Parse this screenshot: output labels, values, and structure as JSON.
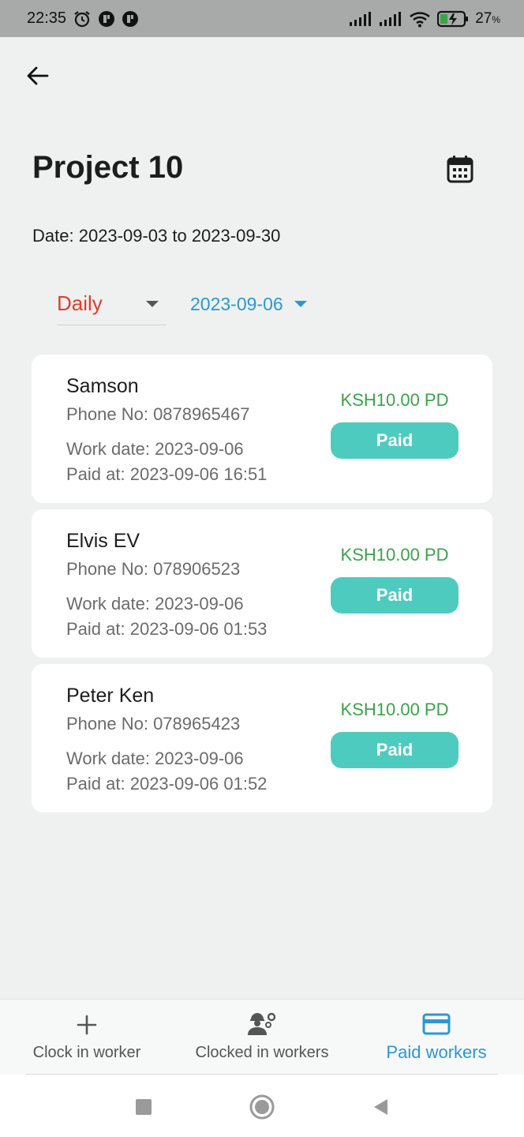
{
  "status_bar": {
    "time": "22:35",
    "battery_percent": "27",
    "battery_unit": "%",
    "icons": [
      "alarm-icon",
      "app-notification-icon",
      "app-notification-icon",
      "signal-icon",
      "signal-icon",
      "wifi-icon",
      "battery-charging-icon"
    ]
  },
  "header": {
    "title": "Project 10",
    "date_label": "Date:",
    "date_range": "2023-09-03 to 2023-09-30"
  },
  "filters": {
    "period": "Daily",
    "selected_date": "2023-09-06"
  },
  "labels": {
    "phone_prefix": "Phone No: ",
    "work_date_prefix": "Work date: ",
    "paid_at_prefix": "Paid at: "
  },
  "workers": [
    {
      "name": "Samson",
      "phone": "Phone No: 0878965467",
      "work_date": "Work date: 2023-09-06",
      "paid_at": "Paid at: 2023-09-06 16:51",
      "amount": "KSH10.00 PD",
      "status": "Paid"
    },
    {
      "name": "Elvis EV",
      "phone": "Phone No: 078906523",
      "work_date": "Work date: 2023-09-06",
      "paid_at": "Paid at: 2023-09-06 01:53",
      "amount": "KSH10.00 PD",
      "status": "Paid"
    },
    {
      "name": "Peter Ken",
      "phone": "Phone No: 078965423",
      "work_date": "Work date: 2023-09-06",
      "paid_at": "Paid at: 2023-09-06 01:52",
      "amount": "KSH10.00 PD",
      "status": "Paid"
    }
  ],
  "bottom_nav": {
    "items": [
      {
        "label": "Clock in worker",
        "icon": "plus-icon",
        "active": false
      },
      {
        "label": "Clocked in workers",
        "icon": "workers-icon",
        "active": false
      },
      {
        "label": "Paid workers",
        "icon": "card-icon",
        "active": true
      }
    ]
  },
  "colors": {
    "accent": "#2b97d6",
    "period_text": "#e53a2c",
    "amount_text": "#3aa34a",
    "paid_button": "#4ecbbf",
    "background": "#eef1f0"
  }
}
